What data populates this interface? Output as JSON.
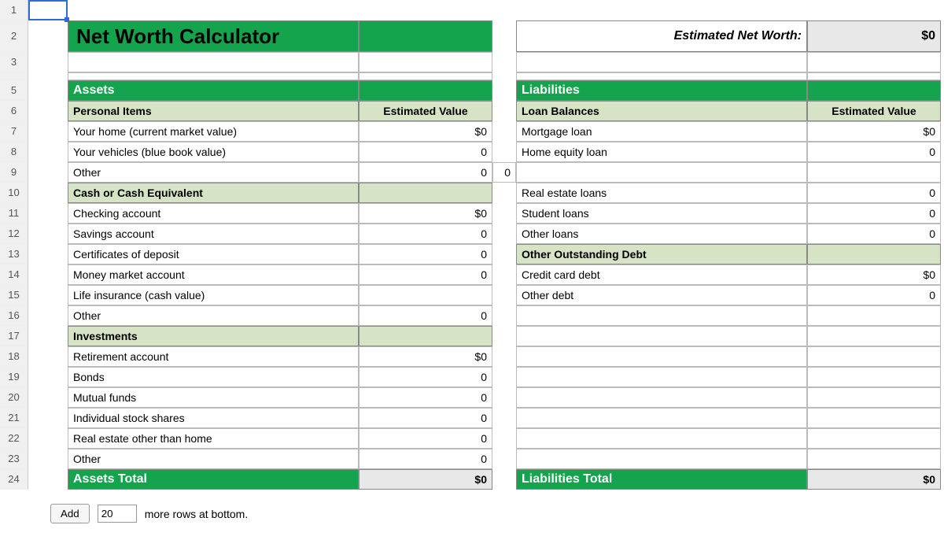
{
  "title": "Net Worth Calculator",
  "networth_label": "Estimated Net Worth:",
  "networth_value": "$0",
  "row_labels": [
    "1",
    "2",
    "3",
    "",
    "5",
    "6",
    "7",
    "8",
    "9",
    "10",
    "11",
    "12",
    "13",
    "14",
    "15",
    "16",
    "17",
    "18",
    "19",
    "20",
    "21",
    "22",
    "23",
    "24"
  ],
  "assets": {
    "header": "Assets",
    "value_header": "Estimated Value",
    "groups": [
      {
        "name": "Personal Items",
        "rows": [
          {
            "label": "Your home (current market value)",
            "value": "$0"
          },
          {
            "label": "Your vehicles (blue book value)",
            "value": "0"
          },
          {
            "label": "Other",
            "value": "0"
          }
        ]
      },
      {
        "name": "Cash or Cash Equivalent",
        "rows": [
          {
            "label": "Checking account",
            "value": "$0"
          },
          {
            "label": "Savings account",
            "value": "0"
          },
          {
            "label": "Certificates of deposit",
            "value": "0"
          },
          {
            "label": "Money market account",
            "value": "0"
          },
          {
            "label": "Life insurance (cash value)",
            "value": ""
          },
          {
            "label": "Other",
            "value": "0"
          }
        ]
      },
      {
        "name": "Investments",
        "rows": [
          {
            "label": "Retirement account",
            "value": "$0"
          },
          {
            "label": "Bonds",
            "value": "0"
          },
          {
            "label": "Mutual funds",
            "value": "0"
          },
          {
            "label": "Individual stock shares",
            "value": "0"
          },
          {
            "label": "Real estate other than home",
            "value": "0"
          },
          {
            "label": "Other",
            "value": "0"
          }
        ]
      }
    ],
    "total_label": "Assets Total",
    "total_value": "$0"
  },
  "liabilities": {
    "header": "Liabilities",
    "value_header": "Estimated Value",
    "groups": [
      {
        "name": "Loan Balances",
        "rows": [
          {
            "label": "Mortgage loan",
            "value": "$0"
          },
          {
            "label": "Home equity loan",
            "value": "0"
          },
          {
            "label": "",
            "value": ""
          },
          {
            "label": "Real estate loans",
            "value": "0"
          },
          {
            "label": "Student loans",
            "value": "0"
          },
          {
            "label": "Other loans",
            "value": "0"
          }
        ]
      },
      {
        "name": "Other Outstanding Debt",
        "rows": [
          {
            "label": "Credit card debt",
            "value": "$0"
          },
          {
            "label": "Other debt",
            "value": "0"
          }
        ]
      }
    ],
    "total_label": "Liabilities Total",
    "total_value": "$0"
  },
  "stray_zero": "0",
  "footer": {
    "add": "Add",
    "count": "20",
    "suffix": "more rows at bottom."
  }
}
